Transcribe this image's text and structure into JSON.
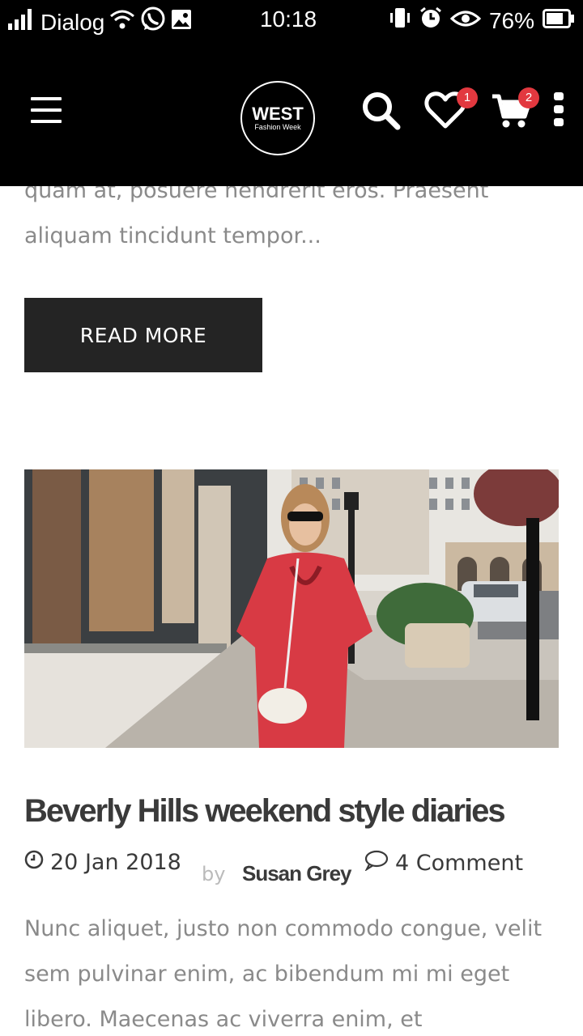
{
  "status_bar": {
    "carrier": "Dialog",
    "time": "10:18",
    "battery": "76%"
  },
  "header": {
    "logo_main": "WEST",
    "logo_sub": "Fashion Week",
    "wishlist_count": "1",
    "cart_count": "2"
  },
  "previous_post": {
    "excerpt": "quam at, posuere hendrerit eros. Praesent aliquam tincidunt tempor...",
    "read_more_label": "READ MORE"
  },
  "post": {
    "title": "Beverly Hills weekend style diaries",
    "date": "20 Jan 2018",
    "by_label": "by",
    "author": "Susan Grey",
    "comments": "4 Comment",
    "excerpt": "Nunc aliquet, justo non commodo congue, velit sem pulvinar enim, ac bibendum mi mi eget libero. Maecenas ac viverra enim, et"
  },
  "icons": {
    "menu": "menu-icon",
    "search": "search-icon",
    "wishlist": "heart-icon",
    "cart": "cart-icon",
    "more": "more-vertical-icon",
    "clock": "clock-icon",
    "comment": "comment-icon"
  },
  "colors": {
    "header_bg": "#000000",
    "button_bg": "#242424",
    "badge": "#e2383f",
    "body_text": "#8a8a8a",
    "heading_text": "#3a3a3a"
  }
}
